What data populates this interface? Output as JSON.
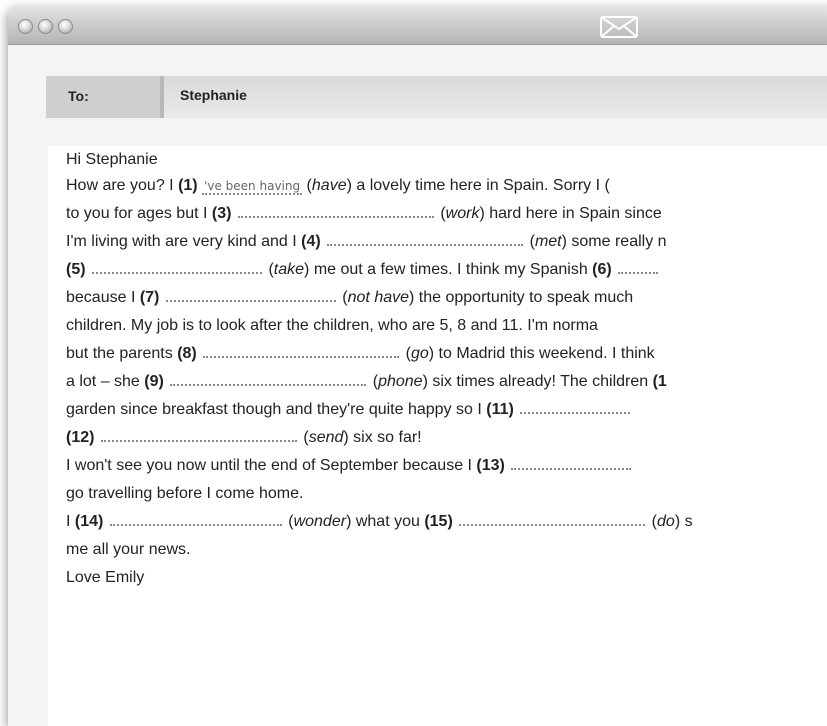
{
  "recipient": {
    "label": "To:",
    "value": "Stephanie"
  },
  "email": {
    "greeting": "Hi Stephanie",
    "line1": {
      "a": "How are you? I ",
      "n1": "(1)",
      "answer": "'ve been having",
      "b": " (",
      "v1": "have",
      "c": ") a lovely time here in Spain. Sorry I ("
    },
    "line2": {
      "a": "to you for ages but I ",
      "n3": "(3)",
      "b": " (",
      "v3": "work",
      "c": ") hard here in Spain since"
    },
    "line3": {
      "a": "I'm living with are very kind and I ",
      "n4": "(4)",
      "b": " (",
      "v4": "met",
      "c": ") some really n"
    },
    "line4": {
      "n5": "(5)",
      "a": " (",
      "v5": "take",
      "b": ") me out a few times. I think my Spanish ",
      "n6": "(6)"
    },
    "line5": {
      "a": "because I ",
      "n7": "(7)",
      "b": " (",
      "v7": "not have",
      "c": ") the opportunity to speak much"
    },
    "line6": {
      "a": "children. My job is to look after the children, who are 5, 8 and 11. I'm norma"
    },
    "line7": {
      "a": "but the parents ",
      "n8": "(8)",
      "b": " (",
      "v8": "go",
      "c": ") to Madrid this weekend. I think"
    },
    "line8": {
      "a": "a lot – she ",
      "n9": "(9)",
      "b": " (",
      "v9": "phone",
      "c": ") six times already! The children ",
      "n10": "(1"
    },
    "line9": {
      "a": "garden since breakfast though and they're quite happy so I ",
      "n11": "(11)"
    },
    "line10": {
      "n12": "(12)",
      "a": " (",
      "v12": "send",
      "b": ") six so far!"
    },
    "line11": {
      "a": "I won't see you now until the end of September because I ",
      "n13": "(13)"
    },
    "line12": {
      "a": "go travelling before I come home."
    },
    "line13": {
      "a": "I ",
      "n14": "(14)",
      "b": " (",
      "v14": "wonder",
      "c": ") what you ",
      "n15": "(15)",
      "d": " (",
      "v15": "do",
      "e": ") s"
    },
    "line14": {
      "a": "me all your news."
    },
    "signoff": "Love Emily"
  },
  "icons": [
    "traffic-light-close-icon",
    "traffic-light-minimize-icon",
    "traffic-light-zoom-icon",
    "envelope-icon"
  ]
}
